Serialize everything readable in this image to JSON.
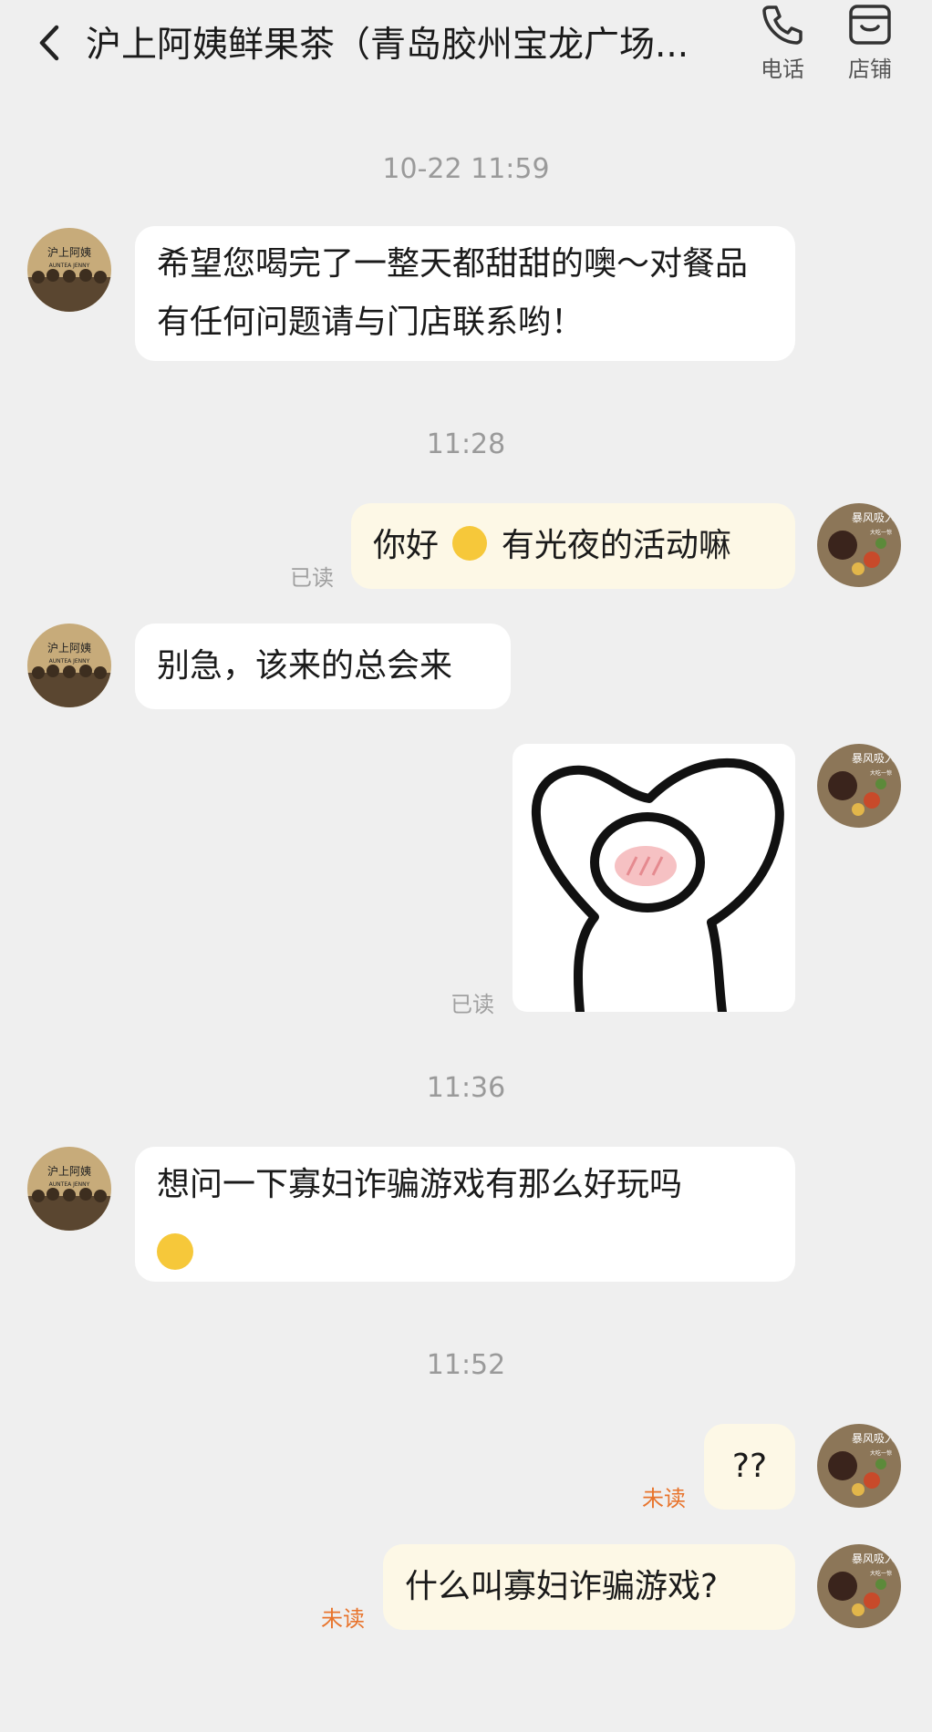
{
  "header": {
    "title": "沪上阿姨鲜果茶（青岛胶州宝龙广场...",
    "phone_label": "电话",
    "store_label": "店铺"
  },
  "avatars": {
    "store_text_top": "沪上阿姨",
    "store_text_bottom": "AUNTEA JENNY",
    "user_text": "暴风吸入",
    "user_text_small": "大吃一惊"
  },
  "messages": {
    "time_1": "10-22 11:59",
    "msg_1": "希望您喝完了一整天都甜甜的噢～对餐品有任何问题请与门店联系哟！",
    "time_2": "11:28",
    "msg_2_a": "你好",
    "msg_2_b": "有光夜的活动嘛",
    "msg_2_status": "已读",
    "msg_3": "别急，该来的总会来",
    "msg_4_status": "已读",
    "time_3": "11:36",
    "msg_5": "想问一下寡妇诈骗游戏有那么好玩吗",
    "time_4": "11:52",
    "msg_6": "??",
    "msg_6_status": "未读",
    "msg_7": "什么叫寡妇诈骗游戏?",
    "msg_7_status": "未读"
  },
  "colors": {
    "background": "#efefef",
    "incoming_bubble": "#ffffff",
    "outgoing_bubble": "#fdf8e6",
    "unread": "#e8742c",
    "read": "#a0a0a0"
  }
}
